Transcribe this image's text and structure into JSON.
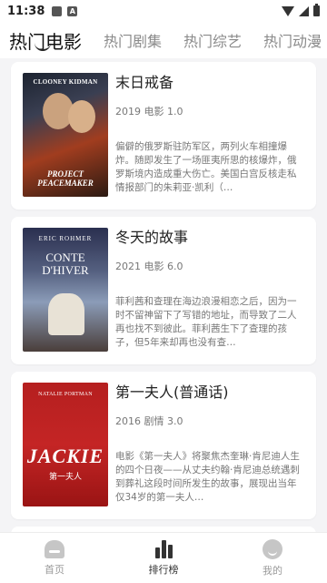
{
  "status_bar": {
    "time": "11:38"
  },
  "tabs": [
    {
      "label": "热门电影",
      "active": true
    },
    {
      "label": "热门剧集",
      "active": false
    },
    {
      "label": "热门综艺",
      "active": false
    },
    {
      "label": "热门动漫",
      "active": false
    }
  ],
  "movies": [
    {
      "title": "末日戒备",
      "meta": "2019 电影 1.0",
      "description": "偏僻的俄罗斯驻防军区，两列火车相撞爆炸。随即发生了一场匪夷所思的核爆炸，俄罗斯境内造成重大伤亡。美国白宫反核走私情报部门的朱莉亚·凯利（…",
      "poster": {
        "top_text": "CLOONEY   KIDMAN",
        "bottom_text": "PROJECT PEACEMAKER"
      }
    },
    {
      "title": "冬天的故事",
      "meta": "2021 电影 6.0",
      "description": "菲利茜和查理在海边浪漫相恋之后，因为一时不留神留下了写错的地址，而导致了二人再也找不到彼此。菲利茜生下了查理的孩子，但5年来却再也没有查…",
      "poster": {
        "top_text": "ERIC ROHMER",
        "mid_text": "CONTE D'HIVER"
      }
    },
    {
      "title": "第一夫人(普通话)",
      "meta": "2016 剧情 3.0",
      "description": "电影《第一夫人》将聚焦杰奎琳·肯尼迪人生的四个日夜——从丈夫约翰·肯尼迪总统遇刺到葬礼这段时间所发生的故事，展现出当年仅34岁的第一夫人…",
      "poster": {
        "top_text": "NATALIE PORTMAN",
        "mid_text": "JACKIE",
        "sub_text": "第一夫人"
      }
    }
  ],
  "bottom_nav": [
    {
      "label": "首页",
      "icon": "home-icon",
      "active": false
    },
    {
      "label": "排行榜",
      "icon": "ranking-icon",
      "active": true
    },
    {
      "label": "我的",
      "icon": "profile-icon",
      "active": false
    }
  ]
}
